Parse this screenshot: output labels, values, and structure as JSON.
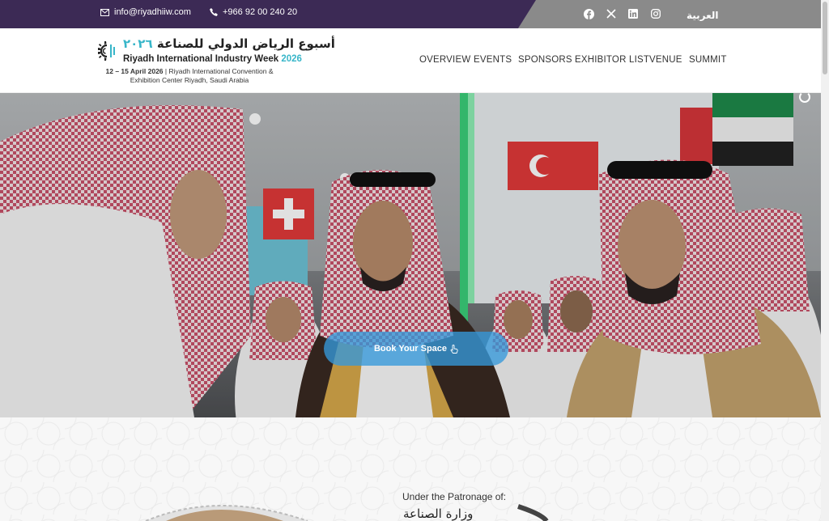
{
  "topbar": {
    "email": "info@riyadhiiw.com",
    "phone": "+966 92 00 240 20",
    "social": [
      "facebook-icon",
      "x-icon",
      "linkedin-icon",
      "instagram-icon"
    ],
    "lang": "العربية"
  },
  "header": {
    "logo_ar": "أسبوع الرياض الدولي للصناعة",
    "logo_ar_year": "٢٠٢٦",
    "logo_en": "Riyadh International Industry Week",
    "logo_en_year": "2026",
    "date": "12 – 15 April 2026",
    "venue": "| Riyadh International Convention & Exhibition Center Riyadh, Saudi Arabia"
  },
  "nav": [
    "OVERVIEW",
    "EVENTS",
    "SPONSORS",
    "EXHIBITOR LIST",
    "VENUE",
    "SUMMIT"
  ],
  "hero": {
    "cta": "Book Your Space"
  },
  "patronage": {
    "label": "Under the Patronage of:",
    "ministry": "وزارة الصناعة"
  },
  "colors": {
    "topbar": "#3c2a55",
    "accent": "#38b6c9",
    "cta": "#3498db"
  }
}
